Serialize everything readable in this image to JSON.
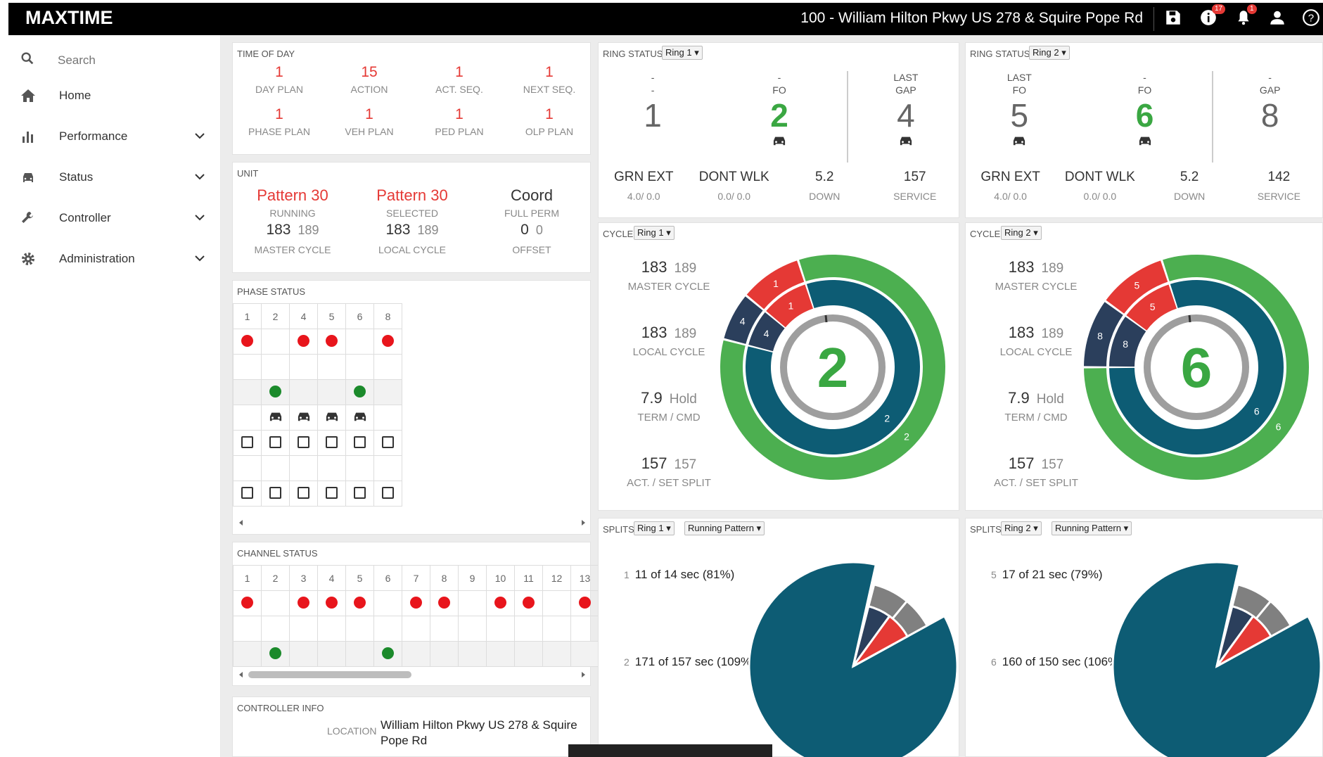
{
  "app": {
    "title": "MAXTIME",
    "intersection": "100 - William Hilton Pkwy US 278 & Squire Pope Rd",
    "badges": {
      "info": "17",
      "alerts": "1"
    },
    "icons": [
      "save-icon",
      "info-icon",
      "bell-icon",
      "user-icon",
      "help-icon"
    ]
  },
  "sidebar": {
    "search_placeholder": "Search",
    "items": [
      {
        "label": "Home",
        "icon": "home-icon"
      },
      {
        "label": "Performance",
        "icon": "bar-chart-icon"
      },
      {
        "label": "Status",
        "icon": "car-icon"
      },
      {
        "label": "Controller",
        "icon": "wrench-icon"
      },
      {
        "label": "Administration",
        "icon": "gear-icon"
      }
    ]
  },
  "time_of_day": {
    "title": "Time of Day",
    "row1": [
      {
        "value": "1",
        "label": "Day Plan"
      },
      {
        "value": "15",
        "label": "Action"
      },
      {
        "value": "1",
        "label": "Act. Seq."
      },
      {
        "value": "1",
        "label": "Next Seq."
      }
    ],
    "row2": [
      {
        "value": "1",
        "label": "Phase Plan"
      },
      {
        "value": "1",
        "label": "Veh Plan"
      },
      {
        "value": "1",
        "label": "Ped Plan"
      },
      {
        "value": "1",
        "label": "OLP Plan"
      }
    ]
  },
  "unit": {
    "title": "Unit",
    "cols": [
      {
        "top": "Pattern 30",
        "status": "Running",
        "val": "183",
        "sub": "189",
        "label": "Master Cycle"
      },
      {
        "top": "Pattern 30",
        "status": "Selected",
        "val": "183",
        "sub": "189",
        "label": "Local Cycle"
      },
      {
        "top": "Coord",
        "status": "Full Perm",
        "val": "0",
        "sub": "0",
        "label": "Offset"
      }
    ]
  },
  "phase_status": {
    "title": "Phase Status",
    "headers": [
      "1",
      "2",
      "4",
      "5",
      "6",
      "8"
    ],
    "red": [
      1,
      0,
      1,
      1,
      0,
      1
    ],
    "green": [
      0,
      1,
      0,
      0,
      1,
      0
    ],
    "veh": [
      0,
      1,
      1,
      1,
      1,
      0
    ]
  },
  "channel_status": {
    "title": "Channel Status",
    "headers": [
      "1",
      "2",
      "3",
      "4",
      "5",
      "6",
      "7",
      "8",
      "9",
      "10",
      "11",
      "12",
      "13"
    ],
    "red": [
      1,
      0,
      1,
      1,
      1,
      0,
      1,
      1,
      0,
      1,
      1,
      0,
      1
    ],
    "green": [
      0,
      1,
      0,
      0,
      0,
      1,
      0,
      0,
      0,
      0,
      0,
      0,
      0
    ]
  },
  "controller_info": {
    "title": "Controller Info",
    "location_label": "Location",
    "location_line1": "William Hilton Pkwy US 278 & Squire",
    "location_line2": "Pope Rd"
  },
  "ring_status": [
    {
      "title": "Ring Status",
      "ring": "Ring 1 ▾",
      "phases": [
        {
          "top1": "-",
          "top2": "-",
          "num": "1",
          "color": "gray",
          "car": false
        },
        {
          "top1": "-",
          "top2": "FO",
          "num": "2",
          "color": "green",
          "car": true
        },
        {
          "top1": "Last",
          "top2": "Gap",
          "num": "4",
          "color": "gray",
          "car": true
        }
      ],
      "stats": [
        {
          "val": "GRN EXT",
          "sub": "4.0/ 0.0"
        },
        {
          "val": "DONT WLK",
          "sub": "0.0/ 0.0"
        },
        {
          "val": "5.2",
          "sub": "Down"
        },
        {
          "val": "157",
          "sub": "Service"
        }
      ]
    },
    {
      "title": "Ring Status",
      "ring": "Ring 2 ▾",
      "phases": [
        {
          "top1": "Last",
          "top2": "FO",
          "num": "5",
          "color": "gray",
          "car": true
        },
        {
          "top1": "-",
          "top2": "FO",
          "num": "6",
          "color": "green",
          "car": true
        },
        {
          "top1": "-",
          "top2": "Gap",
          "num": "8",
          "color": "gray",
          "car": false
        }
      ],
      "stats": [
        {
          "val": "GRN EXT",
          "sub": "4.0/ 0.0"
        },
        {
          "val": "DONT WLK",
          "sub": "0.0/ 0.0"
        },
        {
          "val": "5.2",
          "sub": "Down"
        },
        {
          "val": "142",
          "sub": "Service"
        }
      ]
    }
  ],
  "cycle": [
    {
      "title": "Cycle",
      "ring": "Ring 1 ▾",
      "center": "2",
      "rows": [
        {
          "val": "183",
          "sub": "189",
          "label": "Master Cycle"
        },
        {
          "val": "183",
          "sub": "189",
          "label": "Local Cycle"
        },
        {
          "val": "7.9",
          "sub": "Hold",
          "label": "Term / CMD"
        },
        {
          "val": "157",
          "sub": "157",
          "label": "Act. / Set Split"
        }
      ],
      "outer": [
        {
          "p": "2",
          "c": "#4caf50",
          "a": 0.84
        },
        {
          "p": "4",
          "c": "#2b3f5c",
          "a": 0.07
        },
        {
          "p": "1",
          "c": "#e53935",
          "a": 0.09
        }
      ],
      "inner": [
        {
          "p": "2",
          "c": "#0d5c74",
          "a": 0.84
        },
        {
          "p": "4",
          "c": "#2b3f5c",
          "a": 0.07
        },
        {
          "p": "1",
          "c": "#e53935",
          "a": 0.09
        }
      ]
    },
    {
      "title": "Cycle",
      "ring": "Ring 2 ▾",
      "center": "6",
      "rows": [
        {
          "val": "183",
          "sub": "189",
          "label": "Master Cycle"
        },
        {
          "val": "183",
          "sub": "189",
          "label": "Local Cycle"
        },
        {
          "val": "7.9",
          "sub": "Hold",
          "label": "Term / CMD"
        },
        {
          "val": "157",
          "sub": "157",
          "label": "Act. / Set Split"
        }
      ],
      "outer": [
        {
          "p": "6",
          "c": "#4caf50",
          "a": 0.8
        },
        {
          "p": "8",
          "c": "#2b3f5c",
          "a": 0.1
        },
        {
          "p": "5",
          "c": "#e53935",
          "a": 0.1
        }
      ],
      "inner": [
        {
          "p": "6",
          "c": "#0d5c74",
          "a": 0.8
        },
        {
          "p": "8",
          "c": "#2b3f5c",
          "a": 0.1
        },
        {
          "p": "5",
          "c": "#e53935",
          "a": 0.1
        }
      ]
    }
  ],
  "splits": [
    {
      "title": "Splits",
      "ring": "Ring 1 ▾",
      "pattern": "Running Pattern ▾",
      "lines": [
        {
          "num": "1",
          "text": "11 of 14 sec (81%)"
        },
        {
          "num": "2",
          "text": "171 of 157 sec (109%)"
        }
      ]
    },
    {
      "title": "Splits",
      "ring": "Ring 2 ▾",
      "pattern": "Running Pattern ▾",
      "lines": [
        {
          "num": "5",
          "text": "17 of 21 sec (79%)"
        },
        {
          "num": "6",
          "text": "160 of 150 sec (106%)"
        }
      ]
    }
  ],
  "colors": {
    "red": "#e53935",
    "green": "#3aa742",
    "teal": "#0d5c74",
    "navy": "#2b3f5c",
    "ring_green": "#4caf50"
  }
}
